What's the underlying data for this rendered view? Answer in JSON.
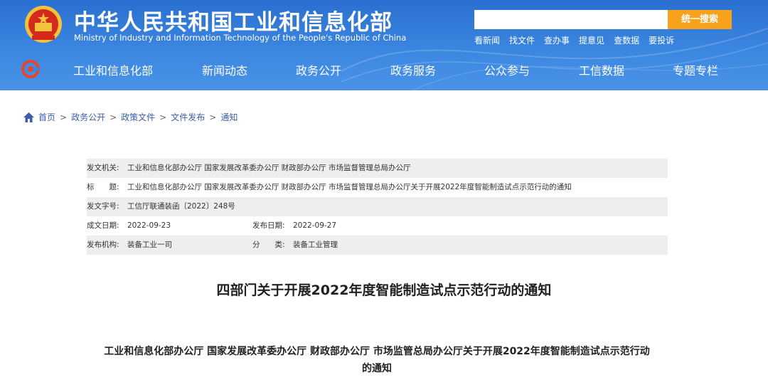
{
  "header": {
    "title_cn": "中华人民共和国工业和信息化部",
    "title_en": "Ministry of Industry and Information Technology of the People's Republic of China",
    "search_placeholder": "",
    "search_button": "统一搜索",
    "quick_links": [
      "看新闻",
      "找文件",
      "查办事",
      "提意见",
      "查数据",
      "要投诉"
    ]
  },
  "nav": {
    "items": [
      "工业和信息化部",
      "新闻动态",
      "政务公开",
      "政务服务",
      "公众参与",
      "工信数据",
      "专题专栏"
    ]
  },
  "breadcrumb": {
    "items": [
      "首页",
      "政务公开",
      "政策文件",
      "文件发布",
      "通知"
    ],
    "separator": ">"
  },
  "meta": {
    "issuer_label": "发文机关:",
    "issuer_value": "工业和信息化部办公厅 国家发展改革委办公厅 财政部办公厅 市场监督管理总局办公厅",
    "title_label": "标　　题:",
    "title_value": "工业和信息化部办公厅 国家发展改革委办公厅 财政部办公厅 市场监督管理总局办公厅关于开展2022年度智能制造试点示范行动的通知",
    "docno_label": "发文字号:",
    "docno_value": "工信厅联通装函〔2022〕248号",
    "created_label": "成文日期:",
    "created_value": "2022-09-23",
    "published_label": "发布日期:",
    "published_value": "2022-09-27",
    "org_label": "发布机构:",
    "org_value": "装备工业一司",
    "category_label": "分　　类:",
    "category_value": "装备工业管理"
  },
  "document": {
    "title": "四部门关于开展2022年度智能制造试点示范行动的通知",
    "subtitle_line1": "工业和信息化部办公厅 国家发展改革委办公厅 财政部办公厅 市场监管总局办公厅关于开展2022年度智能制造试点示范行动",
    "subtitle_line2": "的通知"
  },
  "colors": {
    "header_blue": "#3b86e0",
    "search_button": "#f7a21a",
    "link_blue": "#3a5ea8",
    "meta_shade": "#eeeeee"
  }
}
